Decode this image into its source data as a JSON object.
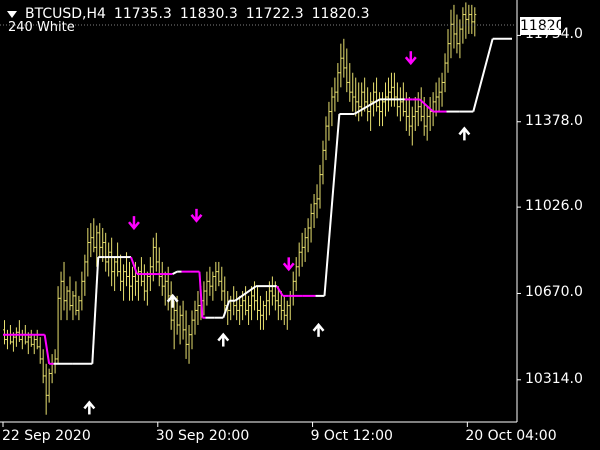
{
  "header": {
    "symbol": "BTCUSD,H4",
    "open": "11735.3",
    "high": "11830.3",
    "low": "11722.3",
    "close": "11820.3"
  },
  "indicator_label": "240 White",
  "colors": {
    "background": "#000000",
    "candles": "#e8e070",
    "line_up": "#ffffff",
    "line_down": "#ff00ff",
    "arrow_up": "#ffffff",
    "arrow_down": "#ff00ff",
    "axis": "#ffffff"
  },
  "chart_data": {
    "type": "line",
    "title": "",
    "xlabel": "",
    "ylabel": "",
    "current_price": "11820.3",
    "y_ticks": [
      "11734.0",
      "11378.0",
      "11026.0",
      "10670.0",
      "10314.0"
    ],
    "x_ticks": [
      "22 Sep 2020",
      "30 Sep 20:00",
      "9 Oct 12:00",
      "20 Oct 04:00"
    ],
    "ylim": [
      10140,
      11880
    ],
    "xlim": [
      0,
      171
    ],
    "x_tick_index": [
      0,
      52,
      104,
      156
    ],
    "trend_line": [
      {
        "range": [
          0,
          14
        ],
        "value": 10500,
        "color": "down"
      },
      {
        "range": [
          14,
          17
        ],
        "value": 10380,
        "color": "down"
      },
      {
        "range": [
          17,
          30
        ],
        "value": 10380,
        "color": "up"
      },
      {
        "range": [
          30,
          34
        ],
        "value": 10820,
        "color": "up"
      },
      {
        "range": [
          34,
          43
        ],
        "value": 10820,
        "color": "up"
      },
      {
        "range": [
          43,
          47
        ],
        "value": 10750,
        "color": "down"
      },
      {
        "range": [
          47,
          57
        ],
        "value": 10750,
        "color": "down"
      },
      {
        "range": [
          57,
          60
        ],
        "value": 10760,
        "color": "up"
      },
      {
        "range": [
          60,
          66
        ],
        "value": 10760,
        "color": "down"
      },
      {
        "range": [
          66,
          68
        ],
        "value": 10570,
        "color": "down"
      },
      {
        "range": [
          68,
          74
        ],
        "value": 10570,
        "color": "up"
      },
      {
        "range": [
          74,
          78
        ],
        "value": 10640,
        "color": "up"
      },
      {
        "range": [
          78,
          92
        ],
        "value": 10700,
        "color": "up"
      },
      {
        "range": [
          92,
          96
        ],
        "value": 10660,
        "color": "down"
      },
      {
        "range": [
          96,
          105
        ],
        "value": 10660,
        "color": "down"
      },
      {
        "range": [
          105,
          108
        ],
        "value": 10660,
        "color": "up"
      },
      {
        "range": [
          108,
          118
        ],
        "value": 11410,
        "color": "up"
      },
      {
        "range": [
          118,
          135
        ],
        "value": 11470,
        "color": "up"
      },
      {
        "range": [
          135,
          140
        ],
        "value": 11470,
        "color": "down"
      },
      {
        "range": [
          140,
          149
        ],
        "value": 11420,
        "color": "down"
      },
      {
        "range": [
          149,
          158
        ],
        "value": 11420,
        "color": "up"
      },
      {
        "range": [
          158,
          171
        ],
        "value": 11720,
        "color": "up"
      }
    ],
    "buy_signals": [
      {
        "x": 29,
        "price": 10200
      },
      {
        "x": 57,
        "price": 10640
      },
      {
        "x": 74,
        "price": 10480
      },
      {
        "x": 106,
        "price": 10520
      },
      {
        "x": 155,
        "price": 11330
      }
    ],
    "sell_signals": [
      {
        "x": 44,
        "price": 10960
      },
      {
        "x": 65,
        "price": 10990
      },
      {
        "x": 96,
        "price": 10790
      },
      {
        "x": 137,
        "price": 11640
      }
    ],
    "candles": [
      [
        10520,
        10560,
        10460,
        10480
      ],
      [
        10480,
        10520,
        10440,
        10500
      ],
      [
        10500,
        10540,
        10460,
        10470
      ],
      [
        10470,
        10510,
        10430,
        10490
      ],
      [
        10490,
        10530,
        10450,
        10510
      ],
      [
        10510,
        10560,
        10470,
        10480
      ],
      [
        10480,
        10520,
        10440,
        10500
      ],
      [
        10500,
        10540,
        10460,
        10470
      ],
      [
        10470,
        10510,
        10420,
        10490
      ],
      [
        10490,
        10520,
        10450,
        10460
      ],
      [
        10460,
        10500,
        10420,
        10480
      ],
      [
        10480,
        10520,
        10440,
        10450
      ],
      [
        10450,
        10490,
        10380,
        10400
      ],
      [
        10400,
        10440,
        10300,
        10330
      ],
      [
        10330,
        10380,
        10170,
        10250
      ],
      [
        10250,
        10360,
        10220,
        10340
      ],
      [
        10340,
        10420,
        10300,
        10380
      ],
      [
        10380,
        10440,
        10340,
        10400
      ],
      [
        10400,
        10700,
        10380,
        10650
      ],
      [
        10650,
        10760,
        10560,
        10720
      ],
      [
        10720,
        10800,
        10600,
        10640
      ],
      [
        10640,
        10700,
        10560,
        10680
      ],
      [
        10680,
        10740,
        10600,
        10620
      ],
      [
        10620,
        10680,
        10560,
        10660
      ],
      [
        10660,
        10720,
        10580,
        10600
      ],
      [
        10600,
        10660,
        10560,
        10640
      ],
      [
        10640,
        10760,
        10600,
        10720
      ],
      [
        10720,
        10830,
        10660,
        10800
      ],
      [
        10800,
        10940,
        10740,
        10880
      ],
      [
        10880,
        10960,
        10820,
        10900
      ],
      [
        10900,
        10980,
        10840,
        10860
      ],
      [
        10860,
        10950,
        10780,
        10920
      ],
      [
        10920,
        10960,
        10820,
        10860
      ],
      [
        10860,
        10940,
        10800,
        10880
      ],
      [
        10880,
        10920,
        10760,
        10800
      ],
      [
        10800,
        10880,
        10740,
        10840
      ],
      [
        10840,
        10900,
        10700,
        10760
      ],
      [
        10760,
        10820,
        10680,
        10800
      ],
      [
        10800,
        10880,
        10740,
        10760
      ],
      [
        10760,
        10830,
        10680,
        10720
      ],
      [
        10720,
        10790,
        10640,
        10760
      ],
      [
        10760,
        10840,
        10700,
        10740
      ],
      [
        10740,
        10800,
        10640,
        10700
      ],
      [
        10700,
        10780,
        10640,
        10740
      ],
      [
        10740,
        10800,
        10660,
        10720
      ],
      [
        10720,
        10780,
        10640,
        10760
      ],
      [
        10760,
        10820,
        10700,
        10720
      ],
      [
        10720,
        10790,
        10640,
        10680
      ],
      [
        10680,
        10760,
        10620,
        10740
      ],
      [
        10740,
        10820,
        10680,
        10780
      ],
      [
        10780,
        10900,
        10720,
        10860
      ],
      [
        10860,
        10920,
        10760,
        10800
      ],
      [
        10800,
        10860,
        10700,
        10740
      ],
      [
        10740,
        10800,
        10660,
        10700
      ],
      [
        10700,
        10760,
        10620,
        10720
      ],
      [
        10720,
        10780,
        10600,
        10660
      ],
      [
        10660,
        10720,
        10520,
        10560
      ],
      [
        10560,
        10640,
        10440,
        10600
      ],
      [
        10600,
        10660,
        10500,
        10540
      ],
      [
        10540,
        10620,
        10460,
        10580
      ],
      [
        10580,
        10640,
        10480,
        10520
      ],
      [
        10520,
        10600,
        10400,
        10460
      ],
      [
        10460,
        10540,
        10380,
        10500
      ],
      [
        10500,
        10600,
        10440,
        10560
      ],
      [
        10560,
        10640,
        10500,
        10600
      ],
      [
        10600,
        10680,
        10540,
        10620
      ],
      [
        10620,
        10700,
        10560,
        10640
      ],
      [
        10640,
        10720,
        10580,
        10680
      ],
      [
        10680,
        10760,
        10620,
        10720
      ],
      [
        10720,
        10780,
        10660,
        10700
      ],
      [
        10700,
        10760,
        10640,
        10740
      ],
      [
        10740,
        10800,
        10680,
        10760
      ],
      [
        10760,
        10800,
        10700,
        10720
      ],
      [
        10720,
        10780,
        10640,
        10680
      ],
      [
        10680,
        10740,
        10580,
        10620
      ],
      [
        10620,
        10680,
        10540,
        10600
      ],
      [
        10600,
        10660,
        10560,
        10640
      ],
      [
        10640,
        10700,
        10580,
        10620
      ],
      [
        10620,
        10680,
        10560,
        10600
      ],
      [
        10600,
        10660,
        10540,
        10620
      ],
      [
        10620,
        10680,
        10560,
        10640
      ],
      [
        10640,
        10700,
        10580,
        10600
      ],
      [
        10600,
        10660,
        10540,
        10620
      ],
      [
        10620,
        10700,
        10560,
        10660
      ],
      [
        10660,
        10720,
        10600,
        10640
      ],
      [
        10640,
        10700,
        10560,
        10600
      ],
      [
        10600,
        10660,
        10520,
        10580
      ],
      [
        10580,
        10640,
        10520,
        10620
      ],
      [
        10620,
        10680,
        10560,
        10640
      ],
      [
        10640,
        10720,
        10580,
        10680
      ],
      [
        10680,
        10740,
        10620,
        10660
      ],
      [
        10660,
        10720,
        10600,
        10640
      ],
      [
        10640,
        10700,
        10560,
        10620
      ],
      [
        10620,
        10680,
        10560,
        10600
      ],
      [
        10600,
        10660,
        10540,
        10580
      ],
      [
        10580,
        10640,
        10520,
        10620
      ],
      [
        10620,
        10680,
        10560,
        10660
      ],
      [
        10660,
        10760,
        10620,
        10720
      ],
      [
        10720,
        10820,
        10680,
        10780
      ],
      [
        10780,
        10880,
        10740,
        10840
      ],
      [
        10840,
        10920,
        10780,
        10860
      ],
      [
        10860,
        10940,
        10800,
        10900
      ],
      [
        10900,
        10980,
        10840,
        10940
      ],
      [
        10940,
        11040,
        10880,
        11000
      ],
      [
        11000,
        11080,
        10940,
        11040
      ],
      [
        11040,
        11120,
        10980,
        11060
      ],
      [
        11060,
        11200,
        11020,
        11160
      ],
      [
        11160,
        11300,
        11120,
        11260
      ],
      [
        11260,
        11400,
        11220,
        11360
      ],
      [
        11360,
        11460,
        11300,
        11420
      ],
      [
        11420,
        11520,
        11360,
        11480
      ],
      [
        11480,
        11560,
        11420,
        11500
      ],
      [
        11500,
        11620,
        11460,
        11580
      ],
      [
        11580,
        11700,
        11520,
        11640
      ],
      [
        11640,
        11720,
        11560,
        11600
      ],
      [
        11600,
        11680,
        11500,
        11540
      ],
      [
        11540,
        11620,
        11460,
        11500
      ],
      [
        11500,
        11580,
        11420,
        11480
      ],
      [
        11480,
        11560,
        11400,
        11460
      ],
      [
        11460,
        11540,
        11380,
        11440
      ],
      [
        11440,
        11540,
        11400,
        11500
      ],
      [
        11500,
        11560,
        11420,
        11460
      ],
      [
        11460,
        11520,
        11380,
        11420
      ],
      [
        11420,
        11500,
        11340,
        11460
      ],
      [
        11460,
        11540,
        11400,
        11500
      ],
      [
        11500,
        11560,
        11420,
        11440
      ],
      [
        11440,
        11500,
        11360,
        11420
      ],
      [
        11420,
        11500,
        11360,
        11460
      ],
      [
        11460,
        11540,
        11400,
        11480
      ],
      [
        11480,
        11560,
        11420,
        11500
      ],
      [
        11500,
        11580,
        11440,
        11520
      ],
      [
        11520,
        11580,
        11440,
        11480
      ],
      [
        11480,
        11540,
        11400,
        11440
      ],
      [
        11440,
        11520,
        11380,
        11460
      ],
      [
        11460,
        11540,
        11400,
        11420
      ],
      [
        11420,
        11500,
        11340,
        11400
      ],
      [
        11400,
        11480,
        11320,
        11360
      ],
      [
        11360,
        11440,
        11280,
        11400
      ],
      [
        11400,
        11480,
        11340,
        11420
      ],
      [
        11420,
        11500,
        11360,
        11440
      ],
      [
        11440,
        11520,
        11380,
        11400
      ],
      [
        11400,
        11480,
        11320,
        11360
      ],
      [
        11360,
        11440,
        11300,
        11400
      ],
      [
        11400,
        11480,
        11340,
        11420
      ],
      [
        11420,
        11500,
        11360,
        11460
      ],
      [
        11460,
        11540,
        11400,
        11480
      ],
      [
        11480,
        11560,
        11420,
        11500
      ],
      [
        11500,
        11580,
        11440,
        11540
      ],
      [
        11540,
        11660,
        11500,
        11620
      ],
      [
        11620,
        11760,
        11580,
        11700
      ],
      [
        11700,
        11840,
        11640,
        11780
      ],
      [
        11780,
        11860,
        11680,
        11740
      ],
      [
        11740,
        11820,
        11660,
        11700
      ],
      [
        11700,
        11800,
        11640,
        11760
      ],
      [
        11760,
        11850,
        11700,
        11820
      ],
      [
        11820,
        11870,
        11720,
        11800
      ],
      [
        11800,
        11860,
        11740,
        11820
      ],
      [
        11820,
        11860,
        11740,
        11790
      ],
      [
        11790,
        11850,
        11730,
        11820
      ]
    ]
  }
}
